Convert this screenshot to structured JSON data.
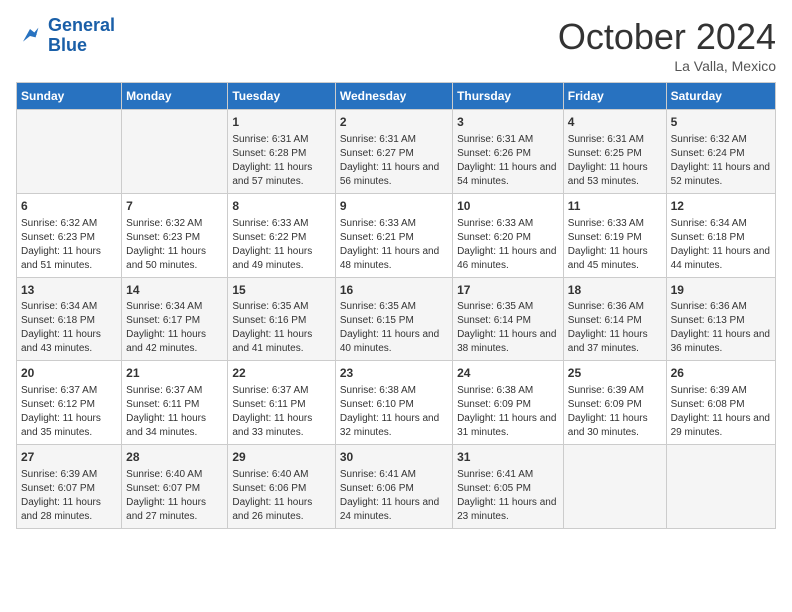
{
  "logo": {
    "line1": "General",
    "line2": "Blue"
  },
  "title": "October 2024",
  "location": "La Valla, Mexico",
  "days_header": [
    "Sunday",
    "Monday",
    "Tuesday",
    "Wednesday",
    "Thursday",
    "Friday",
    "Saturday"
  ],
  "weeks": [
    [
      {
        "day": "",
        "info": ""
      },
      {
        "day": "",
        "info": ""
      },
      {
        "day": "1",
        "info": "Sunrise: 6:31 AM\nSunset: 6:28 PM\nDaylight: 11 hours and 57 minutes."
      },
      {
        "day": "2",
        "info": "Sunrise: 6:31 AM\nSunset: 6:27 PM\nDaylight: 11 hours and 56 minutes."
      },
      {
        "day": "3",
        "info": "Sunrise: 6:31 AM\nSunset: 6:26 PM\nDaylight: 11 hours and 54 minutes."
      },
      {
        "day": "4",
        "info": "Sunrise: 6:31 AM\nSunset: 6:25 PM\nDaylight: 11 hours and 53 minutes."
      },
      {
        "day": "5",
        "info": "Sunrise: 6:32 AM\nSunset: 6:24 PM\nDaylight: 11 hours and 52 minutes."
      }
    ],
    [
      {
        "day": "6",
        "info": "Sunrise: 6:32 AM\nSunset: 6:23 PM\nDaylight: 11 hours and 51 minutes."
      },
      {
        "day": "7",
        "info": "Sunrise: 6:32 AM\nSunset: 6:23 PM\nDaylight: 11 hours and 50 minutes."
      },
      {
        "day": "8",
        "info": "Sunrise: 6:33 AM\nSunset: 6:22 PM\nDaylight: 11 hours and 49 minutes."
      },
      {
        "day": "9",
        "info": "Sunrise: 6:33 AM\nSunset: 6:21 PM\nDaylight: 11 hours and 48 minutes."
      },
      {
        "day": "10",
        "info": "Sunrise: 6:33 AM\nSunset: 6:20 PM\nDaylight: 11 hours and 46 minutes."
      },
      {
        "day": "11",
        "info": "Sunrise: 6:33 AM\nSunset: 6:19 PM\nDaylight: 11 hours and 45 minutes."
      },
      {
        "day": "12",
        "info": "Sunrise: 6:34 AM\nSunset: 6:18 PM\nDaylight: 11 hours and 44 minutes."
      }
    ],
    [
      {
        "day": "13",
        "info": "Sunrise: 6:34 AM\nSunset: 6:18 PM\nDaylight: 11 hours and 43 minutes."
      },
      {
        "day": "14",
        "info": "Sunrise: 6:34 AM\nSunset: 6:17 PM\nDaylight: 11 hours and 42 minutes."
      },
      {
        "day": "15",
        "info": "Sunrise: 6:35 AM\nSunset: 6:16 PM\nDaylight: 11 hours and 41 minutes."
      },
      {
        "day": "16",
        "info": "Sunrise: 6:35 AM\nSunset: 6:15 PM\nDaylight: 11 hours and 40 minutes."
      },
      {
        "day": "17",
        "info": "Sunrise: 6:35 AM\nSunset: 6:14 PM\nDaylight: 11 hours and 38 minutes."
      },
      {
        "day": "18",
        "info": "Sunrise: 6:36 AM\nSunset: 6:14 PM\nDaylight: 11 hours and 37 minutes."
      },
      {
        "day": "19",
        "info": "Sunrise: 6:36 AM\nSunset: 6:13 PM\nDaylight: 11 hours and 36 minutes."
      }
    ],
    [
      {
        "day": "20",
        "info": "Sunrise: 6:37 AM\nSunset: 6:12 PM\nDaylight: 11 hours and 35 minutes."
      },
      {
        "day": "21",
        "info": "Sunrise: 6:37 AM\nSunset: 6:11 PM\nDaylight: 11 hours and 34 minutes."
      },
      {
        "day": "22",
        "info": "Sunrise: 6:37 AM\nSunset: 6:11 PM\nDaylight: 11 hours and 33 minutes."
      },
      {
        "day": "23",
        "info": "Sunrise: 6:38 AM\nSunset: 6:10 PM\nDaylight: 11 hours and 32 minutes."
      },
      {
        "day": "24",
        "info": "Sunrise: 6:38 AM\nSunset: 6:09 PM\nDaylight: 11 hours and 31 minutes."
      },
      {
        "day": "25",
        "info": "Sunrise: 6:39 AM\nSunset: 6:09 PM\nDaylight: 11 hours and 30 minutes."
      },
      {
        "day": "26",
        "info": "Sunrise: 6:39 AM\nSunset: 6:08 PM\nDaylight: 11 hours and 29 minutes."
      }
    ],
    [
      {
        "day": "27",
        "info": "Sunrise: 6:39 AM\nSunset: 6:07 PM\nDaylight: 11 hours and 28 minutes."
      },
      {
        "day": "28",
        "info": "Sunrise: 6:40 AM\nSunset: 6:07 PM\nDaylight: 11 hours and 27 minutes."
      },
      {
        "day": "29",
        "info": "Sunrise: 6:40 AM\nSunset: 6:06 PM\nDaylight: 11 hours and 26 minutes."
      },
      {
        "day": "30",
        "info": "Sunrise: 6:41 AM\nSunset: 6:06 PM\nDaylight: 11 hours and 24 minutes."
      },
      {
        "day": "31",
        "info": "Sunrise: 6:41 AM\nSunset: 6:05 PM\nDaylight: 11 hours and 23 minutes."
      },
      {
        "day": "",
        "info": ""
      },
      {
        "day": "",
        "info": ""
      }
    ]
  ]
}
